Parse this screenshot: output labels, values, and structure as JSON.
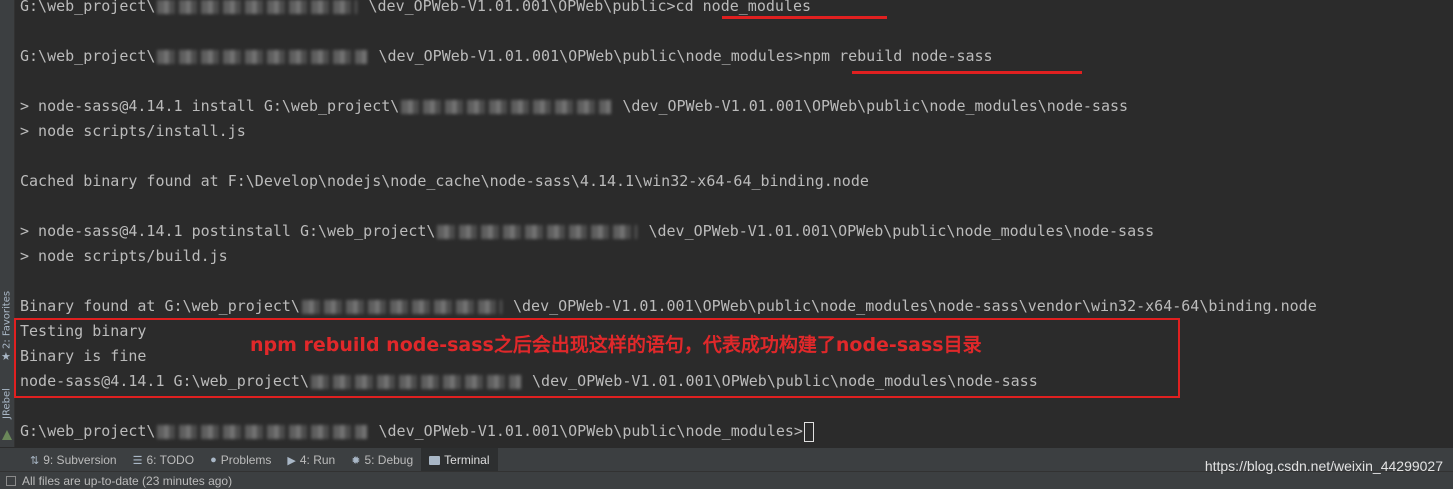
{
  "side": {
    "favorites": "2: Favorites",
    "jrebel": "JRebel",
    "favorites_icon": "star-icon"
  },
  "terminal": {
    "l1_prefix": "G:\\web_project\\",
    "l1_suffix": " \\dev_OPWeb-V1.01.001\\OPWeb\\public>cd node_modules",
    "l2_prefix": "G:\\web_project\\",
    "l2_suffix": " \\dev_OPWeb-V1.01.001\\OPWeb\\public\\node_modules>npm rebuild node-sass",
    "l3_prefix": "> node-sass@4.14.1 install G:\\web_project\\",
    "l3_suffix": " \\dev_OPWeb-V1.01.001\\OPWeb\\public\\node_modules\\node-sass",
    "l4": "> node scripts/install.js",
    "l5": "Cached binary found at F:\\Develop\\nodejs\\node_cache\\node-sass\\4.14.1\\win32-x64-64_binding.node",
    "l6_prefix": "> node-sass@4.14.1 postinstall G:\\web_project\\",
    "l6_suffix": " \\dev_OPWeb-V1.01.001\\OPWeb\\public\\node_modules\\node-sass",
    "l7": "> node scripts/build.js",
    "l8_prefix": "Binary found at G:\\web_project\\",
    "l8_suffix": " \\dev_OPWeb-V1.01.001\\OPWeb\\public\\node_modules\\node-sass\\vendor\\win32-x64-64\\binding.node",
    "l9": "Testing binary",
    "l10": "Binary is fine",
    "l11_prefix": "node-sass@4.14.1 G:\\web_project\\",
    "l11_suffix": " \\dev_OPWeb-V1.01.001\\OPWeb\\public\\node_modules\\node-sass",
    "l12_prefix": "G:\\web_project\\",
    "l12_suffix": " \\dev_OPWeb-V1.01.001\\OPWeb\\public\\node_modules>"
  },
  "annotation": "npm rebuild node-sass之后会出现这样的语句，代表成功构建了node-sass目录",
  "toolbar": {
    "subversion": "9: Subversion",
    "todo": "6: TODO",
    "problems": "Problems",
    "run": "4: Run",
    "debug": "5: Debug",
    "terminal": "Terminal"
  },
  "status": {
    "text": "All files are up-to-date (23 minutes ago)"
  },
  "watermark": "https://blog.csdn.net/weixin_44299027",
  "colors": {
    "background": "#2b2b2b",
    "text": "#bbbbbb",
    "annotation_red": "#e02020"
  }
}
